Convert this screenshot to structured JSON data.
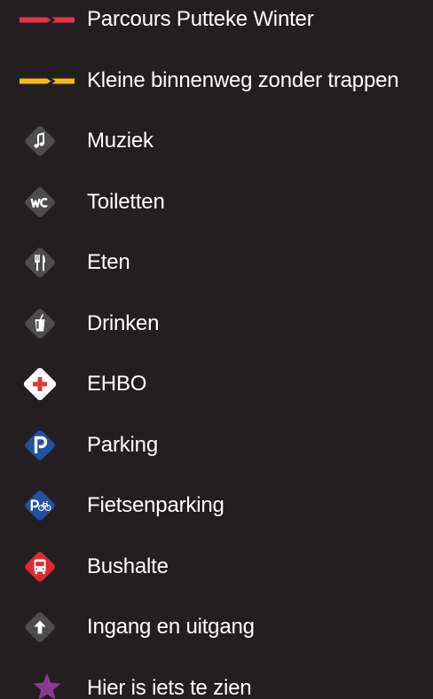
{
  "legend": {
    "items": [
      {
        "label": "Parcours Putteke Winter",
        "symbol": "red-route-arrow-icon",
        "color": "#e8334a"
      },
      {
        "label": "Kleine binnenweg zonder trappen",
        "symbol": "yellow-route-arrow-icon",
        "color": "#f7b718"
      },
      {
        "label": "Muziek",
        "symbol": "music-note-icon",
        "color": "#4d4d4d"
      },
      {
        "label": "Toiletten",
        "symbol": "wc-icon",
        "color": "#4d4d4d"
      },
      {
        "label": "Eten",
        "symbol": "fork-knife-icon",
        "color": "#4d4d4d"
      },
      {
        "label": "Drinken",
        "symbol": "drink-cup-icon",
        "color": "#4d4d4d"
      },
      {
        "label": "EHBO",
        "symbol": "first-aid-cross-icon",
        "color": "#e03a2f"
      },
      {
        "label": "Parking",
        "symbol": "parking-icon",
        "color": "#2350a0"
      },
      {
        "label": "Fietsenparking",
        "symbol": "bike-parking-icon",
        "color": "#2350a0"
      },
      {
        "label": "Bushalte",
        "symbol": "bus-stop-icon",
        "color": "#e02a2f"
      },
      {
        "label": "Ingang en uitgang",
        "symbol": "entrance-exit-arrow-icon",
        "color": "#4d4d4d"
      },
      {
        "label": "Hier is iets te zien",
        "symbol": "star-icon",
        "color": "#8a3a8f"
      }
    ]
  }
}
